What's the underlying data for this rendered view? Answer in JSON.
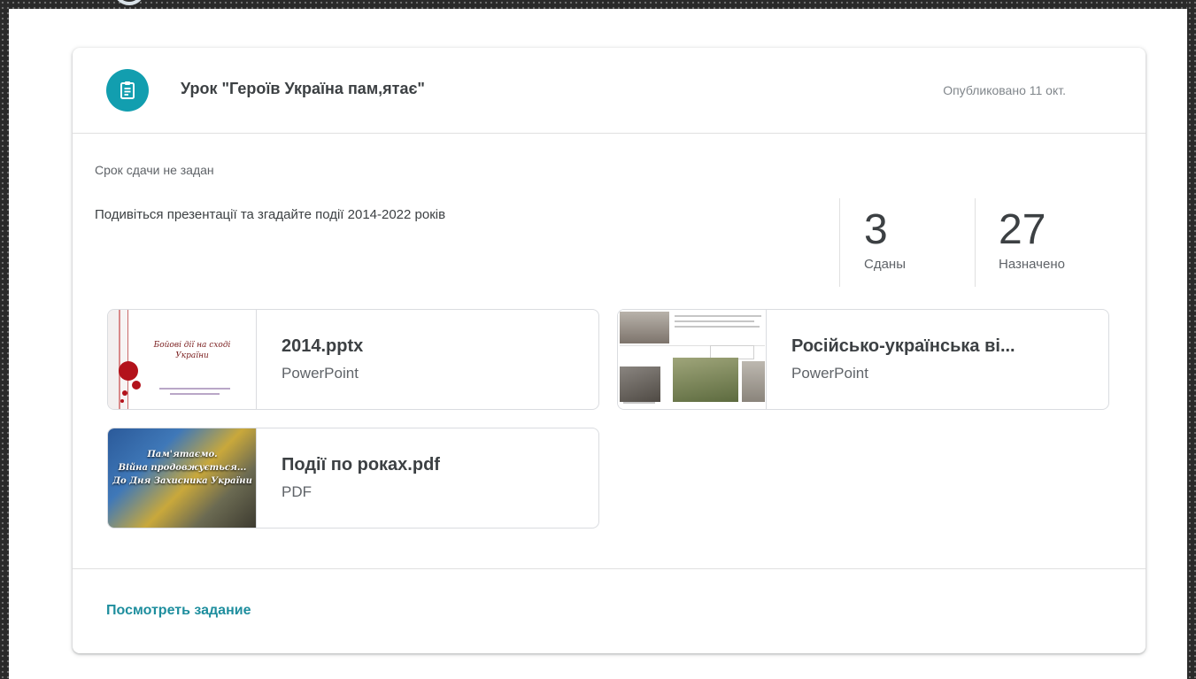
{
  "card": {
    "title": "Урок \"Героїв Україна пам,ятає\"",
    "published": "Опубликовано 11 окт.",
    "due": "Срок сдачи не задан",
    "description": "Подивіться презентації та згадайте події 2014-2022  років"
  },
  "stats": {
    "turned_in": {
      "value": "3",
      "label": "Сданы"
    },
    "assigned": {
      "value": "27",
      "label": "Назначено"
    }
  },
  "attachments": [
    {
      "name": "2014.pptx",
      "type": "PowerPoint",
      "thumb_text": [
        "Бойові дії на сході",
        "України"
      ]
    },
    {
      "name": "Російсько-українська ві...",
      "type": "PowerPoint"
    },
    {
      "name": "Події по роках.pdf",
      "type": "PDF",
      "thumb_text": [
        "Пам'ятаємо.",
        "Війна продовжується...",
        "До Дня Захисника України"
      ]
    }
  ],
  "footer": {
    "view_label": "Посмотреть задание"
  },
  "colors": {
    "accent": "#129eaf",
    "link": "#1e8e9e"
  },
  "icons": {
    "assignment": "assignment-icon"
  }
}
